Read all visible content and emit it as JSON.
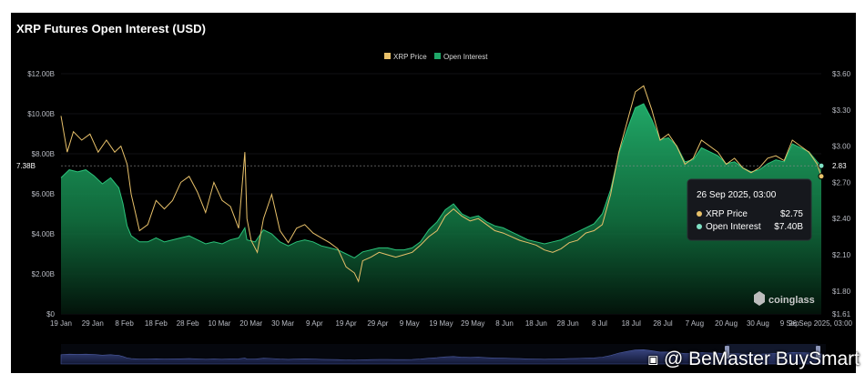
{
  "chart_data": {
    "type": "area",
    "title": "XRP Futures Open Interest (USD)",
    "legend": {
      "placement": "top-center",
      "items": [
        "XRP Price",
        "Open Interest"
      ]
    },
    "x_ticks": [
      "19 Jan",
      "29 Jan",
      "8 Feb",
      "18 Feb",
      "28 Feb",
      "10 Mar",
      "20 Mar",
      "30 Mar",
      "9 Apr",
      "19 Apr",
      "29 Apr",
      "9 May",
      "19 May",
      "29 May",
      "8 Jun",
      "18 Jun",
      "28 Jun",
      "8 Jul",
      "18 Jul",
      "28 Jul",
      "7 Aug",
      "20 Aug",
      "30 Aug",
      "9 Sep",
      "26 Sep 2025, 03:00"
    ],
    "y_left": {
      "ticks": [
        "$0",
        "$2.00B",
        "$4.00B",
        "$6.00B",
        "$8.00B",
        "$10.00B",
        "$12.00B"
      ],
      "range": [
        0,
        12
      ],
      "unit": "B USD",
      "current_label": "7.38B"
    },
    "y_right": {
      "ticks": [
        "$1.61",
        "$1.80",
        "$2.10",
        "$2.40",
        "$2.70",
        "$3.00",
        "$3.30",
        "$3.60"
      ],
      "range": [
        1.61,
        3.6
      ],
      "current_label": "2.83"
    },
    "grid": true,
    "colors": {
      "price": "#e8c16a",
      "oi": "#1fa768",
      "oi_fill_top": "#1b9a5f",
      "oi_fill_bottom": "#062b17",
      "background": "#000000"
    },
    "series": [
      {
        "name": "XRP Price",
        "axis": "right",
        "points": [
          [
            0,
            3.25
          ],
          [
            3,
            2.95
          ],
          [
            6,
            3.12
          ],
          [
            10,
            3.05
          ],
          [
            14,
            3.1
          ],
          [
            18,
            2.95
          ],
          [
            22,
            3.05
          ],
          [
            26,
            2.95
          ],
          [
            29,
            3.0
          ],
          [
            32,
            2.85
          ],
          [
            34,
            2.6
          ],
          [
            36,
            2.45
          ],
          [
            38,
            2.3
          ],
          [
            42,
            2.35
          ],
          [
            46,
            2.55
          ],
          [
            50,
            2.48
          ],
          [
            54,
            2.55
          ],
          [
            58,
            2.7
          ],
          [
            62,
            2.75
          ],
          [
            66,
            2.62
          ],
          [
            70,
            2.45
          ],
          [
            74,
            2.7
          ],
          [
            78,
            2.55
          ],
          [
            82,
            2.5
          ],
          [
            86,
            2.32
          ],
          [
            89,
            2.95
          ],
          [
            90,
            2.4
          ],
          [
            92,
            2.22
          ],
          [
            95,
            2.12
          ],
          [
            98,
            2.4
          ],
          [
            102,
            2.6
          ],
          [
            106,
            2.3
          ],
          [
            110,
            2.2
          ],
          [
            114,
            2.32
          ],
          [
            118,
            2.35
          ],
          [
            122,
            2.28
          ],
          [
            126,
            2.24
          ],
          [
            130,
            2.2
          ],
          [
            134,
            2.15
          ],
          [
            138,
            2.0
          ],
          [
            142,
            1.95
          ],
          [
            144,
            1.88
          ],
          [
            146,
            2.05
          ],
          [
            150,
            2.08
          ],
          [
            154,
            2.12
          ],
          [
            158,
            2.1
          ],
          [
            162,
            2.08
          ],
          [
            166,
            2.1
          ],
          [
            170,
            2.12
          ],
          [
            174,
            2.18
          ],
          [
            178,
            2.25
          ],
          [
            182,
            2.3
          ],
          [
            186,
            2.42
          ],
          [
            190,
            2.48
          ],
          [
            194,
            2.42
          ],
          [
            198,
            2.38
          ],
          [
            202,
            2.4
          ],
          [
            206,
            2.35
          ],
          [
            210,
            2.3
          ],
          [
            214,
            2.28
          ],
          [
            218,
            2.25
          ],
          [
            222,
            2.22
          ],
          [
            226,
            2.2
          ],
          [
            230,
            2.18
          ],
          [
            234,
            2.14
          ],
          [
            238,
            2.12
          ],
          [
            242,
            2.15
          ],
          [
            246,
            2.2
          ],
          [
            250,
            2.22
          ],
          [
            254,
            2.28
          ],
          [
            258,
            2.3
          ],
          [
            262,
            2.35
          ],
          [
            266,
            2.6
          ],
          [
            270,
            2.95
          ],
          [
            274,
            3.2
          ],
          [
            278,
            3.45
          ],
          [
            282,
            3.5
          ],
          [
            286,
            3.3
          ],
          [
            290,
            3.05
          ],
          [
            294,
            3.1
          ],
          [
            298,
            3.0
          ],
          [
            302,
            2.85
          ],
          [
            306,
            2.9
          ],
          [
            310,
            3.05
          ],
          [
            314,
            3.0
          ],
          [
            318,
            2.95
          ],
          [
            322,
            2.85
          ],
          [
            326,
            2.9
          ],
          [
            330,
            2.82
          ],
          [
            334,
            2.78
          ],
          [
            338,
            2.82
          ],
          [
            342,
            2.9
          ],
          [
            346,
            2.92
          ],
          [
            350,
            2.88
          ],
          [
            354,
            3.05
          ],
          [
            358,
            3.0
          ],
          [
            362,
            2.95
          ],
          [
            366,
            2.85
          ],
          [
            368,
            2.75
          ]
        ]
      },
      {
        "name": "Open Interest",
        "axis": "left",
        "points": [
          [
            0,
            6.8
          ],
          [
            4,
            7.2
          ],
          [
            8,
            7.1
          ],
          [
            12,
            7.2
          ],
          [
            16,
            6.9
          ],
          [
            20,
            6.5
          ],
          [
            24,
            6.8
          ],
          [
            28,
            6.3
          ],
          [
            30,
            5.5
          ],
          [
            32,
            4.4
          ],
          [
            34,
            3.9
          ],
          [
            38,
            3.6
          ],
          [
            42,
            3.6
          ],
          [
            46,
            3.8
          ],
          [
            50,
            3.6
          ],
          [
            54,
            3.7
          ],
          [
            58,
            3.8
          ],
          [
            62,
            3.9
          ],
          [
            66,
            3.7
          ],
          [
            70,
            3.5
          ],
          [
            74,
            3.6
          ],
          [
            78,
            3.5
          ],
          [
            82,
            3.7
          ],
          [
            86,
            3.8
          ],
          [
            89,
            4.3
          ],
          [
            90,
            3.7
          ],
          [
            94,
            3.6
          ],
          [
            98,
            4.2
          ],
          [
            102,
            4.0
          ],
          [
            106,
            3.6
          ],
          [
            110,
            3.4
          ],
          [
            114,
            3.6
          ],
          [
            118,
            3.7
          ],
          [
            122,
            3.6
          ],
          [
            126,
            3.4
          ],
          [
            130,
            3.3
          ],
          [
            134,
            3.2
          ],
          [
            138,
            3.0
          ],
          [
            142,
            2.8
          ],
          [
            146,
            3.1
          ],
          [
            150,
            3.2
          ],
          [
            154,
            3.3
          ],
          [
            158,
            3.3
          ],
          [
            162,
            3.2
          ],
          [
            166,
            3.2
          ],
          [
            170,
            3.3
          ],
          [
            174,
            3.6
          ],
          [
            178,
            4.2
          ],
          [
            182,
            4.6
          ],
          [
            186,
            5.2
          ],
          [
            190,
            5.5
          ],
          [
            194,
            5.0
          ],
          [
            198,
            4.8
          ],
          [
            202,
            4.9
          ],
          [
            206,
            4.6
          ],
          [
            210,
            4.4
          ],
          [
            214,
            4.3
          ],
          [
            218,
            4.1
          ],
          [
            222,
            3.9
          ],
          [
            226,
            3.7
          ],
          [
            230,
            3.6
          ],
          [
            234,
            3.5
          ],
          [
            238,
            3.6
          ],
          [
            242,
            3.7
          ],
          [
            246,
            3.9
          ],
          [
            250,
            4.1
          ],
          [
            254,
            4.3
          ],
          [
            258,
            4.5
          ],
          [
            262,
            5.0
          ],
          [
            266,
            6.2
          ],
          [
            270,
            8.0
          ],
          [
            274,
            9.2
          ],
          [
            278,
            10.3
          ],
          [
            282,
            10.5
          ],
          [
            286,
            9.7
          ],
          [
            290,
            8.7
          ],
          [
            294,
            8.8
          ],
          [
            298,
            8.4
          ],
          [
            302,
            7.6
          ],
          [
            306,
            7.7
          ],
          [
            310,
            8.3
          ],
          [
            314,
            8.1
          ],
          [
            318,
            7.9
          ],
          [
            322,
            7.5
          ],
          [
            326,
            7.6
          ],
          [
            330,
            7.3
          ],
          [
            334,
            7.1
          ],
          [
            338,
            7.2
          ],
          [
            342,
            7.5
          ],
          [
            346,
            7.7
          ],
          [
            350,
            7.6
          ],
          [
            354,
            8.5
          ],
          [
            358,
            8.3
          ],
          [
            362,
            8.1
          ],
          [
            366,
            7.6
          ],
          [
            368,
            7.4
          ]
        ]
      }
    ],
    "tooltip": {
      "date": "26 Sep 2025, 03:00",
      "rows": [
        {
          "label": "XRP Price",
          "value": "$2.75",
          "color": "#e8c16a"
        },
        {
          "label": "Open Interest",
          "value": "$7.40B",
          "color": "#7fe0c4"
        }
      ]
    }
  },
  "brand": {
    "logo_text": "coinglass"
  },
  "watermark": {
    "text": "@ BeMaster BuySmart"
  }
}
